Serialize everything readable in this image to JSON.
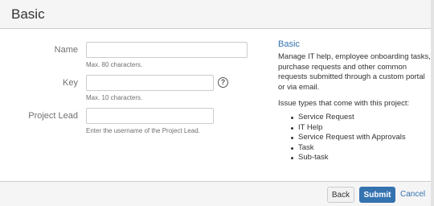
{
  "dialog": {
    "title": "Basic"
  },
  "form": {
    "name": {
      "label": "Name",
      "value": "",
      "hint": "Max. 80 characters."
    },
    "key": {
      "label": "Key",
      "value": "",
      "hint": "Max. 10 characters.",
      "help_icon": "?"
    },
    "project_lead": {
      "label": "Project Lead",
      "value": "",
      "hint": "Enter the username of the Project Lead."
    }
  },
  "info": {
    "title": "Basic",
    "description": "Manage IT help, employee onboarding tasks, purchase requests and other common requests submitted through a custom portal or via email.",
    "issue_types_heading": "Issue types that come with this project:",
    "issue_types": [
      "Service Request",
      "IT Help",
      "Service Request with Approvals",
      "Task",
      "Sub-task"
    ]
  },
  "footer": {
    "back_label": "Back",
    "submit_label": "Submit",
    "cancel_label": "Cancel"
  },
  "colors": {
    "accent": "#3572b0",
    "header_bg": "#f5f5f5",
    "border": "#cccccc"
  }
}
